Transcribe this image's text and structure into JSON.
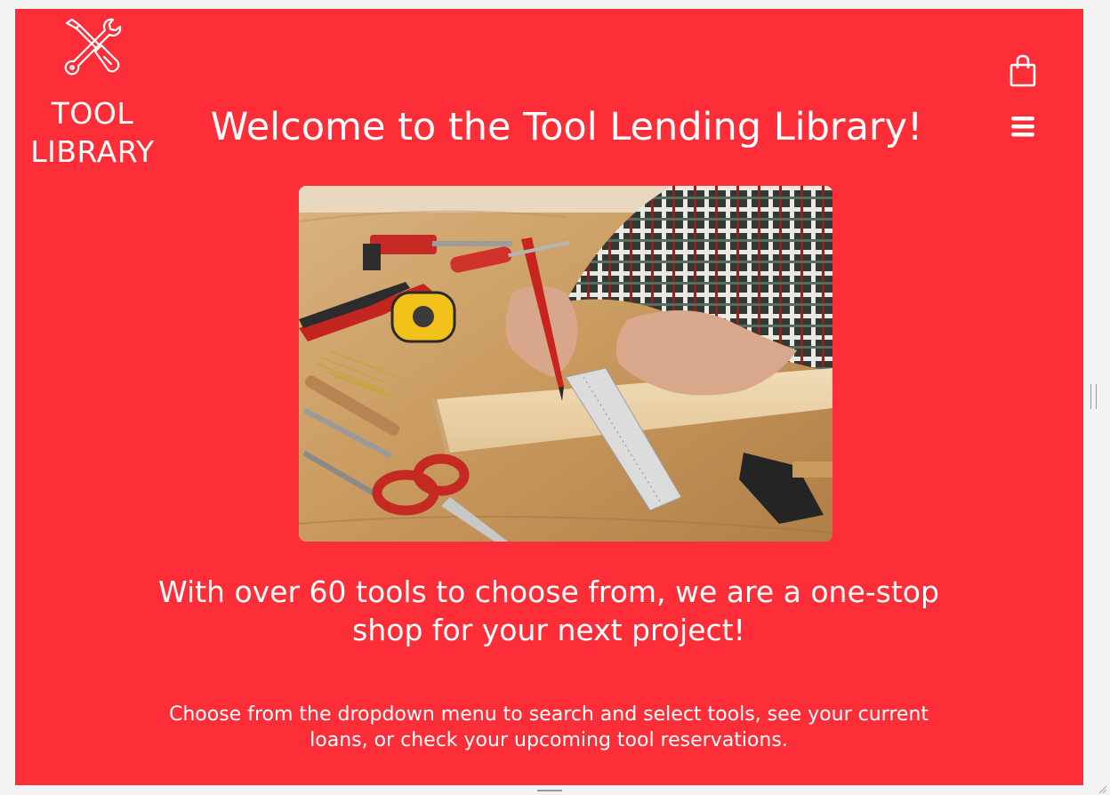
{
  "brand": {
    "logo_icon": "crossed-tools-icon",
    "name_line1": "TOOL",
    "name_line2": "LIBRARY"
  },
  "header": {
    "title": "Welcome to the Tool Lending Library!",
    "cart_icon": "shopping-bag-icon",
    "menu_icon": "hamburger-menu-icon"
  },
  "hero": {
    "image_subject": "hands measuring wood with a ruler and pencil on a workbench surrounded by tools"
  },
  "content": {
    "tagline": "With over 60 tools to choose from, we are a one-stop shop for your next project!",
    "instructions": "Choose from the dropdown menu to search and select tools, see your current loans, or check your upcoming tool reservations."
  },
  "colors": {
    "background": "#fd2e38",
    "text": "#ffffff"
  }
}
